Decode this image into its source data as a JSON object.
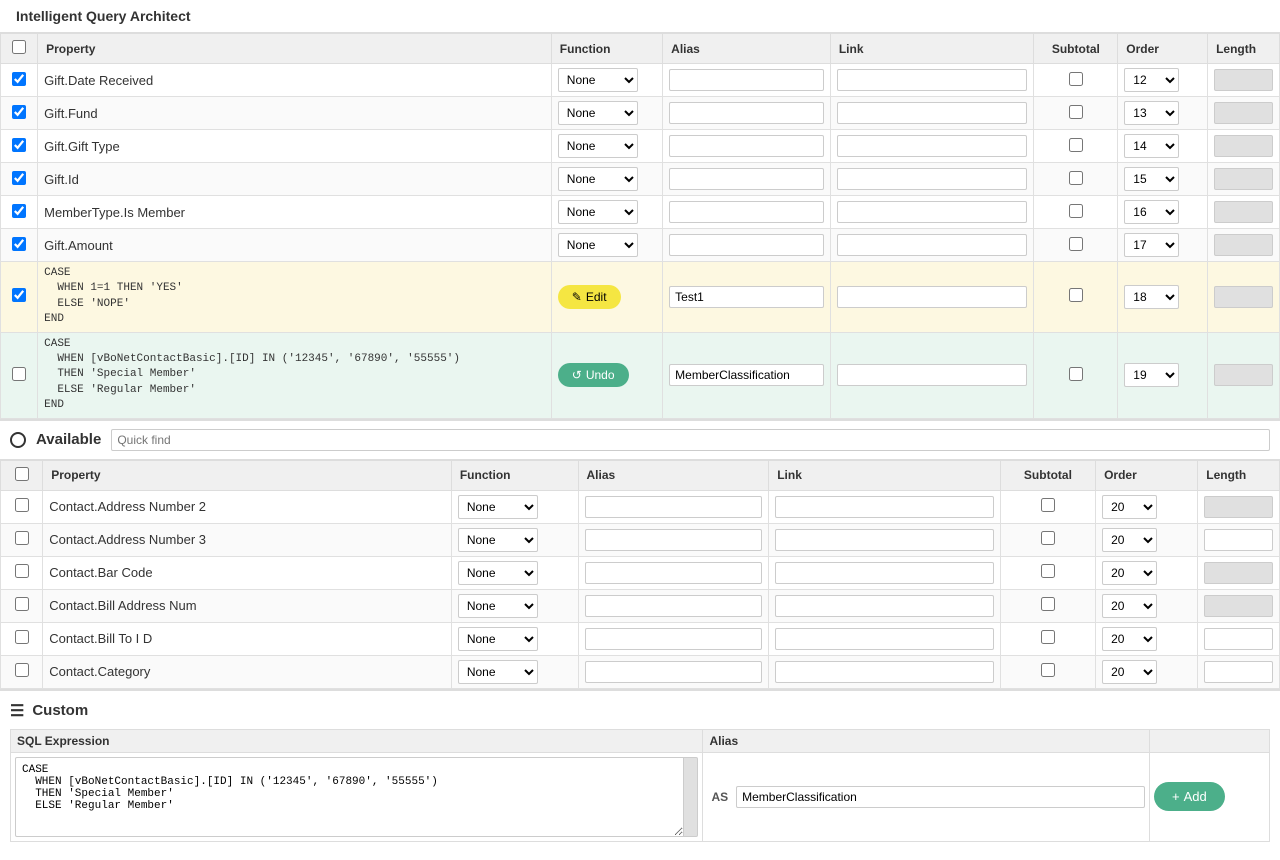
{
  "app": {
    "title": "Intelligent Query Architect"
  },
  "columns": {
    "check": "",
    "property": "Property",
    "function": "Function",
    "alias": "Alias",
    "link": "Link",
    "subtotal": "Subtotal",
    "order": "Order",
    "length": "Length"
  },
  "selected_rows": [
    {
      "checked": true,
      "property": "Gift.Date Received",
      "function": "None",
      "alias": "",
      "link": "",
      "subtotal": false,
      "order": "12",
      "length": "",
      "length_disabled": true
    },
    {
      "checked": true,
      "property": "Gift.Fund",
      "function": "None",
      "alias": "",
      "link": "",
      "subtotal": false,
      "order": "13",
      "length": "",
      "length_disabled": true
    },
    {
      "checked": true,
      "property": "Gift.Gift Type",
      "function": "None",
      "alias": "",
      "link": "",
      "subtotal": false,
      "order": "14",
      "length": "",
      "length_disabled": true
    },
    {
      "checked": true,
      "property": "Gift.Id",
      "function": "None",
      "alias": "",
      "link": "",
      "subtotal": false,
      "order": "15",
      "length": "",
      "length_disabled": true
    },
    {
      "checked": true,
      "property": "MemberType.Is Member",
      "function": "None",
      "alias": "",
      "link": "",
      "subtotal": false,
      "order": "16",
      "length": "",
      "length_disabled": true
    },
    {
      "checked": true,
      "property": "Gift.Amount",
      "function": "None",
      "alias": "",
      "link": "",
      "subtotal": false,
      "order": "17",
      "length": "",
      "length_disabled": true
    }
  ],
  "case_row_edit": {
    "checked": true,
    "code": "CASE\n  WHEN 1=1 THEN 'YES'\n  ELSE 'NOPE'\nEND",
    "button_label": "✎ Edit",
    "alias": "Test1",
    "link": "",
    "subtotal": false,
    "order": "18",
    "length": "",
    "length_disabled": true
  },
  "case_row_undo": {
    "checked": false,
    "code": "CASE\n  WHEN [vBoNetContactBasic].[ID] IN ('12345', '67890', '55555')\n  THEN 'Special Member'\n  ELSE 'Regular Member'\nEND",
    "button_label": "↺ Undo",
    "alias": "MemberClassification",
    "link": "",
    "subtotal": false,
    "order": "19",
    "length": "",
    "length_disabled": true
  },
  "available_section": {
    "title": "Available",
    "quick_find_placeholder": "Quick find"
  },
  "available_columns": {
    "check": "",
    "property": "Property",
    "function": "Function",
    "alias": "Alias",
    "link": "Link",
    "subtotal": "Subtotal",
    "order": "Order",
    "length": "Length"
  },
  "available_rows": [
    {
      "checked": false,
      "property": "Contact.Address Number 2",
      "function": "None",
      "alias": "",
      "link": "",
      "subtotal": false,
      "order": "20",
      "length": "",
      "length_disabled": true
    },
    {
      "checked": false,
      "property": "Contact.Address Number 3",
      "function": "None",
      "alias": "",
      "link": "",
      "subtotal": false,
      "order": "20",
      "length": "",
      "length_disabled": false
    },
    {
      "checked": false,
      "property": "Contact.Bar Code",
      "function": "None",
      "alias": "",
      "link": "",
      "subtotal": false,
      "order": "20",
      "length": "",
      "length_disabled": true
    },
    {
      "checked": false,
      "property": "Contact.Bill Address Num",
      "function": "None",
      "alias": "",
      "link": "",
      "subtotal": false,
      "order": "20",
      "length": "",
      "length_disabled": true
    },
    {
      "checked": false,
      "property": "Contact.Bill To I D",
      "function": "None",
      "alias": "",
      "link": "",
      "subtotal": false,
      "order": "20",
      "length": "",
      "length_disabled": false
    },
    {
      "checked": false,
      "property": "Contact.Category",
      "function": "None",
      "alias": "",
      "link": "",
      "subtotal": false,
      "order": "20",
      "length": "",
      "length_disabled": false
    }
  ],
  "custom_section": {
    "title": "Custom",
    "sql_label": "SQL Expression",
    "alias_label": "Alias",
    "sql_value": "CASE\n  WHEN [vBoNetContactBasic].[ID] IN ('12345', '67890', '55555')\n  THEN 'Special Member'\n  ELSE 'Regular Member'",
    "as_label": "AS",
    "alias_value": "MemberClassification",
    "add_button_label": "+ Add"
  }
}
